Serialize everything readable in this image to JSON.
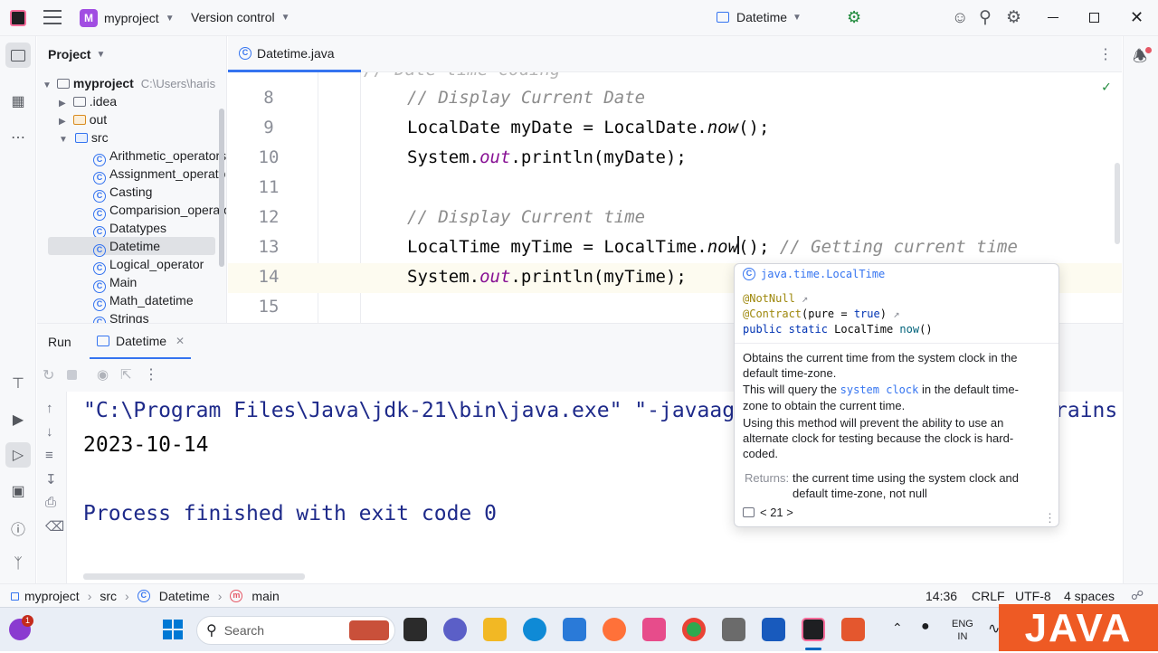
{
  "titlebar": {
    "project_initial": "M",
    "project_name": "myproject",
    "vcs": "Version control",
    "run_config": "Datetime"
  },
  "project_panel": {
    "title": "Project",
    "root": "myproject",
    "root_path": "C:\\Users\\haris",
    "items": [
      {
        "label": ".idea"
      },
      {
        "label": "out"
      },
      {
        "label": "src"
      },
      {
        "label": "Arithmetic_operators"
      },
      {
        "label": "Assignment_operator"
      },
      {
        "label": "Casting"
      },
      {
        "label": "Comparision_operato"
      },
      {
        "label": "Datatypes"
      },
      {
        "label": "Datetime"
      },
      {
        "label": "Logical_operator"
      },
      {
        "label": "Main"
      },
      {
        "label": "Math_datetime"
      },
      {
        "label": "Strings"
      }
    ]
  },
  "editor": {
    "tab": "Datetime.java",
    "lines": [
      {
        "n": "8",
        "code": "// Display Current Date"
      },
      {
        "n": "9",
        "code_a": "LocalDate myDate = LocalDate.",
        "code_b": "now",
        "code_c": "();"
      },
      {
        "n": "10",
        "code_a": "System.",
        "code_b": "out",
        "code_c": ".println(myDate);"
      },
      {
        "n": "11"
      },
      {
        "n": "12",
        "code": "// Display Current time"
      },
      {
        "n": "13",
        "code_a": "LocalTime myTime = LocalTime.",
        "code_b": "now",
        "code_c": "(); ",
        "comment": "// Getting current time"
      },
      {
        "n": "14",
        "code_a": "System.",
        "code_b": "out",
        "code_c": ".println(myTime);"
      },
      {
        "n": "15"
      }
    ]
  },
  "popup": {
    "header": "java.time.LocalTime",
    "ann1": "@NotNull",
    "ann2": "@Contract",
    "ann2_args_a": "(pure = ",
    "ann2_args_b": "true",
    "ann2_args_c": ")",
    "sig_kw": "public static",
    "sig_type": "LocalTime",
    "sig_fn": "now",
    "sig_end": "()",
    "p1": "Obtains the current time from the system clock in the default time-zone.",
    "p2_a": "This will query the ",
    "p2_code": "system clock",
    "p2_b": " in the default time-zone to obtain the current time.",
    "p3": "Using this method will prevent the ability to use an alternate clock for testing because the clock is hard-coded.",
    "returns_label": "Returns:",
    "returns_text": "the current time using the system clock and default time-zone, not null",
    "since": "< 21 >"
  },
  "run": {
    "title": "Run",
    "tab": "Datetime",
    "output": [
      "\"C:\\Program Files\\Java\\jdk-21\\bin\\java.exe\" \"-javaag",
      "2023-10-14",
      "Process finished with exit code 0"
    ],
    "output_tail": "rains"
  },
  "status": {
    "crumbs": [
      "myproject",
      "src",
      "Datetime",
      "main"
    ],
    "position": "14:36",
    "line_sep": "CRLF",
    "encoding": "UTF-8",
    "indent": "4 spaces"
  },
  "taskbar": {
    "search": "Search",
    "lang1": "ENG",
    "lang2": "IN",
    "badge": "1"
  },
  "watermark": "JAVA"
}
